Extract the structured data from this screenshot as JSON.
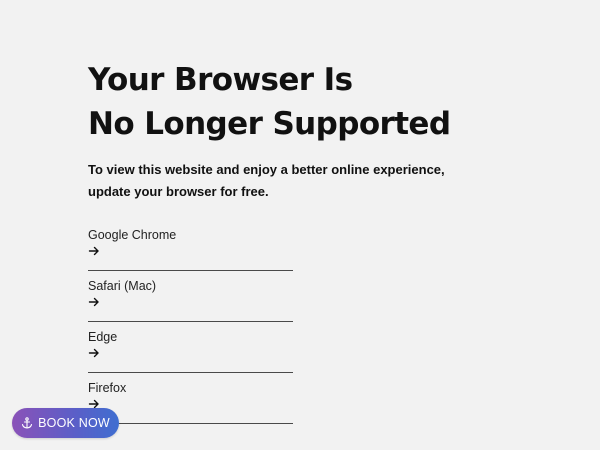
{
  "page": {
    "background_color": "#f2f2f2",
    "title_lines": [
      "Your Browser Is",
      "No Longer Supported"
    ],
    "subtitle_lines": [
      "To view this website and enjoy a better online experience,",
      "update your browser for free."
    ]
  },
  "browsers": [
    {
      "label": "Google Chrome",
      "icon": "arrow-right-icon"
    },
    {
      "label": "Safari (Mac)",
      "icon": "arrow-right-icon"
    },
    {
      "label": "Edge",
      "icon": "arrow-right-icon"
    },
    {
      "label": "Firefox",
      "icon": "arrow-right-icon"
    }
  ],
  "book_button": {
    "label": "BOOK NOW",
    "icon": "anchor-icon",
    "gradient_colors": [
      "#8a52b8",
      "#3f6ed0"
    ]
  }
}
